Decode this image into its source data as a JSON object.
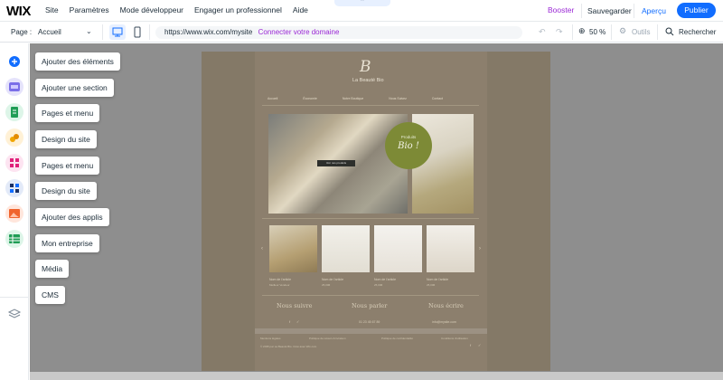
{
  "topbar": {
    "logo": "WIX",
    "menu": [
      "Site",
      "Paramètres",
      "Mode développeur",
      "Engager un professionnel",
      "Aide"
    ],
    "booster": "Booster",
    "save": "Sauvegarder",
    "preview": "Aperçu",
    "publish": "Publier"
  },
  "toolbar": {
    "page_label": "Page :",
    "page_value": "Accueil",
    "url": "https://www.wix.com/mysite",
    "connect_domain": "Connecter votre domaine",
    "zoom": "50 %",
    "tools": "Outils",
    "search": "Rechercher"
  },
  "left_icons": [
    "plus-icon",
    "sections-icon",
    "pages-icon",
    "design-icon",
    "apps-icon",
    "app-market-icon",
    "media-icon",
    "cms-icon",
    "layers-icon"
  ],
  "panel_items": [
    "Ajouter des éléments",
    "Ajouter une section",
    "Pages et menu",
    "Design du site",
    "Pages et menu",
    "Design du site",
    "Ajouter des applis",
    "Mon entreprise",
    "Média",
    "CMS"
  ],
  "site": {
    "logo": "B",
    "title": "La Beauté Bio",
    "nav": [
      "Accueil",
      "Économie",
      "Notre Boutique",
      "Nous Suivez",
      "Contact"
    ],
    "badge_top": "Produits",
    "badge_bottom": "Bio !",
    "image_button": "Voir nos produits",
    "products": [
      {
        "name": "Nom de l'article",
        "price": "Meilleur Vendeur"
      },
      {
        "name": "Nom de l'article",
        "price": "25,00€"
      },
      {
        "name": "Nom de l'article",
        "price": "25,00€"
      },
      {
        "name": "Nom de l'article",
        "price": "25,00€"
      }
    ],
    "footer_heads": [
      "Nous suivre",
      "Nous parler",
      "Nous écrire"
    ],
    "footer_texts": [
      "01 23 45 67 89",
      "info@mysite.com"
    ],
    "footer_links": [
      "Mentions légales",
      "Politique de retours & livraison",
      "Politique de confidentialité",
      "Conditions d'utilisation"
    ],
    "copyright": "© 2035 par La Beauté Bio. Créé avec Wix.com"
  },
  "colors": {
    "brand_blue": "#116dff",
    "booster_purple": "#9a27d5",
    "site_bg": "#847967",
    "badge_green": "#7d8a36"
  }
}
